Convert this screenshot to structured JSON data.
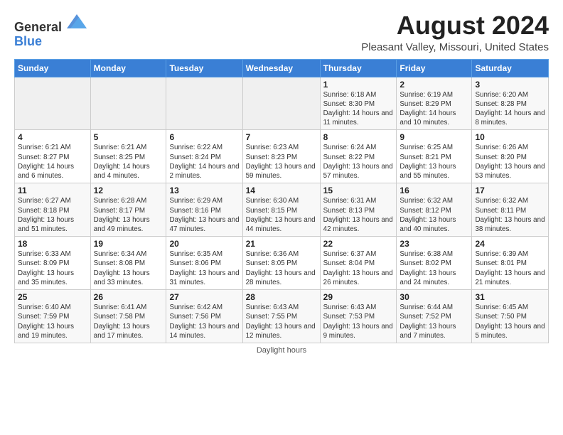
{
  "logo": {
    "text_general": "General",
    "text_blue": "Blue"
  },
  "title": "August 2024",
  "subtitle": "Pleasant Valley, Missouri, United States",
  "days_of_week": [
    "Sunday",
    "Monday",
    "Tuesday",
    "Wednesday",
    "Thursday",
    "Friday",
    "Saturday"
  ],
  "footer": "Daylight hours",
  "weeks": [
    [
      {
        "day": "",
        "info": ""
      },
      {
        "day": "",
        "info": ""
      },
      {
        "day": "",
        "info": ""
      },
      {
        "day": "",
        "info": ""
      },
      {
        "day": "1",
        "info": "Sunrise: 6:18 AM\nSunset: 8:30 PM\nDaylight: 14 hours\nand 11 minutes."
      },
      {
        "day": "2",
        "info": "Sunrise: 6:19 AM\nSunset: 8:29 PM\nDaylight: 14 hours\nand 10 minutes."
      },
      {
        "day": "3",
        "info": "Sunrise: 6:20 AM\nSunset: 8:28 PM\nDaylight: 14 hours\nand 8 minutes."
      }
    ],
    [
      {
        "day": "4",
        "info": "Sunrise: 6:21 AM\nSunset: 8:27 PM\nDaylight: 14 hours\nand 6 minutes."
      },
      {
        "day": "5",
        "info": "Sunrise: 6:21 AM\nSunset: 8:25 PM\nDaylight: 14 hours\nand 4 minutes."
      },
      {
        "day": "6",
        "info": "Sunrise: 6:22 AM\nSunset: 8:24 PM\nDaylight: 14 hours\nand 2 minutes."
      },
      {
        "day": "7",
        "info": "Sunrise: 6:23 AM\nSunset: 8:23 PM\nDaylight: 13 hours\nand 59 minutes."
      },
      {
        "day": "8",
        "info": "Sunrise: 6:24 AM\nSunset: 8:22 PM\nDaylight: 13 hours\nand 57 minutes."
      },
      {
        "day": "9",
        "info": "Sunrise: 6:25 AM\nSunset: 8:21 PM\nDaylight: 13 hours\nand 55 minutes."
      },
      {
        "day": "10",
        "info": "Sunrise: 6:26 AM\nSunset: 8:20 PM\nDaylight: 13 hours\nand 53 minutes."
      }
    ],
    [
      {
        "day": "11",
        "info": "Sunrise: 6:27 AM\nSunset: 8:18 PM\nDaylight: 13 hours\nand 51 minutes."
      },
      {
        "day": "12",
        "info": "Sunrise: 6:28 AM\nSunset: 8:17 PM\nDaylight: 13 hours\nand 49 minutes."
      },
      {
        "day": "13",
        "info": "Sunrise: 6:29 AM\nSunset: 8:16 PM\nDaylight: 13 hours\nand 47 minutes."
      },
      {
        "day": "14",
        "info": "Sunrise: 6:30 AM\nSunset: 8:15 PM\nDaylight: 13 hours\nand 44 minutes."
      },
      {
        "day": "15",
        "info": "Sunrise: 6:31 AM\nSunset: 8:13 PM\nDaylight: 13 hours\nand 42 minutes."
      },
      {
        "day": "16",
        "info": "Sunrise: 6:32 AM\nSunset: 8:12 PM\nDaylight: 13 hours\nand 40 minutes."
      },
      {
        "day": "17",
        "info": "Sunrise: 6:32 AM\nSunset: 8:11 PM\nDaylight: 13 hours\nand 38 minutes."
      }
    ],
    [
      {
        "day": "18",
        "info": "Sunrise: 6:33 AM\nSunset: 8:09 PM\nDaylight: 13 hours\nand 35 minutes."
      },
      {
        "day": "19",
        "info": "Sunrise: 6:34 AM\nSunset: 8:08 PM\nDaylight: 13 hours\nand 33 minutes."
      },
      {
        "day": "20",
        "info": "Sunrise: 6:35 AM\nSunset: 8:06 PM\nDaylight: 13 hours\nand 31 minutes."
      },
      {
        "day": "21",
        "info": "Sunrise: 6:36 AM\nSunset: 8:05 PM\nDaylight: 13 hours\nand 28 minutes."
      },
      {
        "day": "22",
        "info": "Sunrise: 6:37 AM\nSunset: 8:04 PM\nDaylight: 13 hours\nand 26 minutes."
      },
      {
        "day": "23",
        "info": "Sunrise: 6:38 AM\nSunset: 8:02 PM\nDaylight: 13 hours\nand 24 minutes."
      },
      {
        "day": "24",
        "info": "Sunrise: 6:39 AM\nSunset: 8:01 PM\nDaylight: 13 hours\nand 21 minutes."
      }
    ],
    [
      {
        "day": "25",
        "info": "Sunrise: 6:40 AM\nSunset: 7:59 PM\nDaylight: 13 hours\nand 19 minutes."
      },
      {
        "day": "26",
        "info": "Sunrise: 6:41 AM\nSunset: 7:58 PM\nDaylight: 13 hours\nand 17 minutes."
      },
      {
        "day": "27",
        "info": "Sunrise: 6:42 AM\nSunset: 7:56 PM\nDaylight: 13 hours\nand 14 minutes."
      },
      {
        "day": "28",
        "info": "Sunrise: 6:43 AM\nSunset: 7:55 PM\nDaylight: 13 hours\nand 12 minutes."
      },
      {
        "day": "29",
        "info": "Sunrise: 6:43 AM\nSunset: 7:53 PM\nDaylight: 13 hours\nand 9 minutes."
      },
      {
        "day": "30",
        "info": "Sunrise: 6:44 AM\nSunset: 7:52 PM\nDaylight: 13 hours\nand 7 minutes."
      },
      {
        "day": "31",
        "info": "Sunrise: 6:45 AM\nSunset: 7:50 PM\nDaylight: 13 hours\nand 5 minutes."
      }
    ]
  ]
}
